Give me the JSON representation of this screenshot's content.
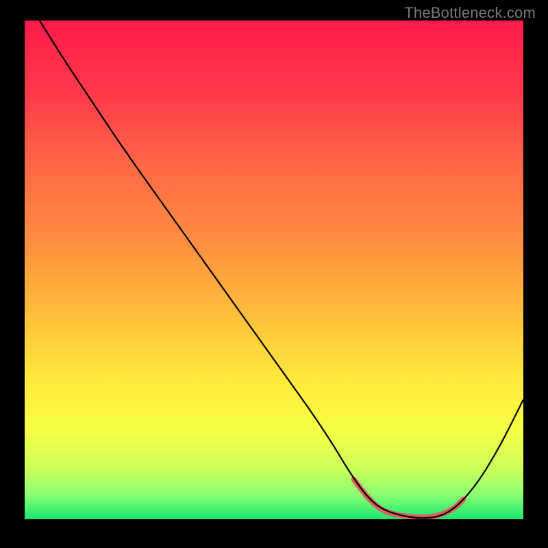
{
  "watermark": "TheBottleneck.com",
  "chart_data": {
    "type": "line",
    "title": "",
    "xlabel": "",
    "ylabel": "",
    "xlim": [
      0,
      100
    ],
    "ylim": [
      0,
      100
    ],
    "grid": false,
    "legend": "none",
    "gradient_stops": [
      {
        "offset": 0,
        "color": "#ff1a4b"
      },
      {
        "offset": 15,
        "color": "#ff3b4a"
      },
      {
        "offset": 30,
        "color": "#ff6a45"
      },
      {
        "offset": 45,
        "color": "#ff8f3f"
      },
      {
        "offset": 60,
        "color": "#ffc23a"
      },
      {
        "offset": 72,
        "color": "#ffe93c"
      },
      {
        "offset": 82,
        "color": "#f7ff44"
      },
      {
        "offset": 90,
        "color": "#cbff5b"
      },
      {
        "offset": 95,
        "color": "#8cff73"
      },
      {
        "offset": 100,
        "color": "#19e86f"
      }
    ],
    "series": [
      {
        "name": "bottleneck-curve",
        "color": "#000000",
        "points": [
          {
            "x": 3,
            "y": 100
          },
          {
            "x": 8,
            "y": 92
          },
          {
            "x": 12,
            "y": 86
          },
          {
            "x": 20,
            "y": 74
          },
          {
            "x": 30,
            "y": 60
          },
          {
            "x": 40,
            "y": 46
          },
          {
            "x": 50,
            "y": 32
          },
          {
            "x": 60,
            "y": 18
          },
          {
            "x": 66,
            "y": 8
          },
          {
            "x": 70,
            "y": 3
          },
          {
            "x": 74,
            "y": 1
          },
          {
            "x": 80,
            "y": 0
          },
          {
            "x": 85,
            "y": 1
          },
          {
            "x": 90,
            "y": 6
          },
          {
            "x": 95,
            "y": 14
          },
          {
            "x": 100,
            "y": 24
          }
        ]
      },
      {
        "name": "optimal-marker",
        "color": "#d9605f",
        "points": [
          {
            "x": 66,
            "y": 8
          },
          {
            "x": 69,
            "y": 4
          },
          {
            "x": 72,
            "y": 1.5
          },
          {
            "x": 76,
            "y": 0.6
          },
          {
            "x": 80,
            "y": 0.3
          },
          {
            "x": 83,
            "y": 0.7
          },
          {
            "x": 86,
            "y": 2
          },
          {
            "x": 88,
            "y": 4
          }
        ]
      }
    ]
  }
}
